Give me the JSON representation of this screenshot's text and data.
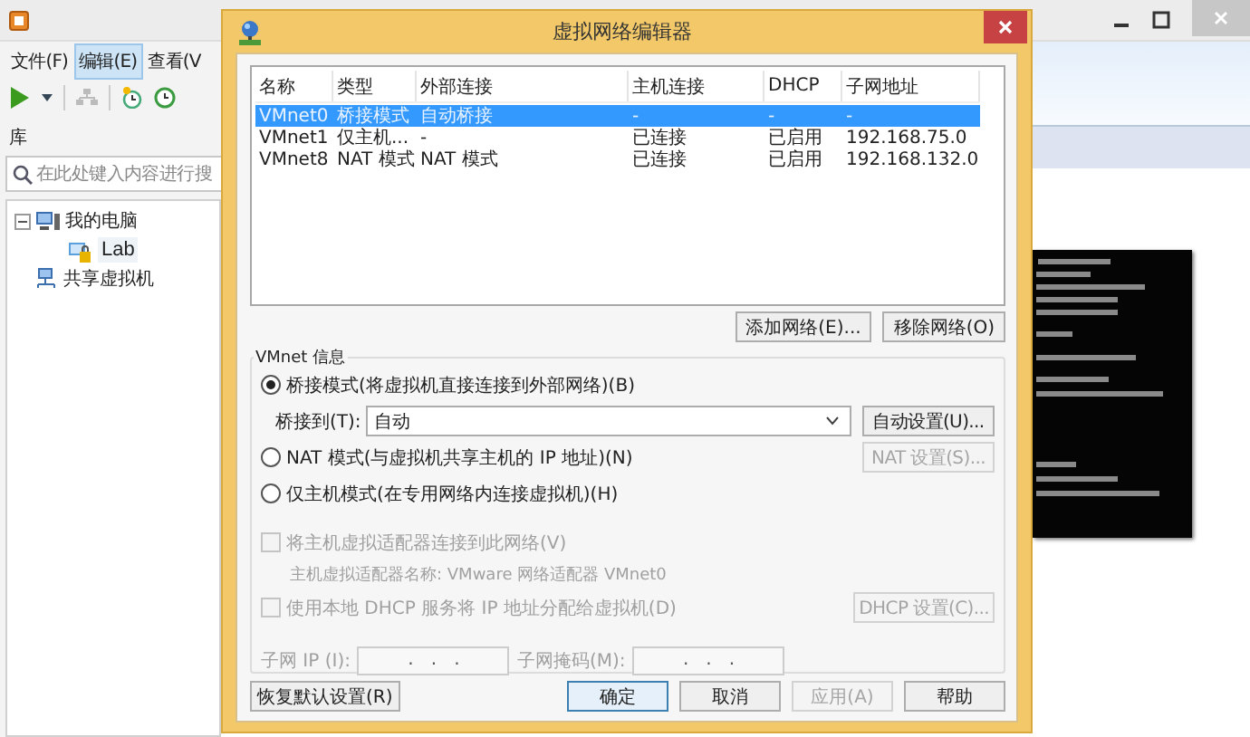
{
  "main_window": {
    "menu": [
      {
        "label": "文件(F)",
        "selected": false
      },
      {
        "label": "编辑(E)",
        "selected": true
      },
      {
        "label": "查看(V",
        "selected": false
      }
    ],
    "library": {
      "title": "库",
      "search": {
        "placeholder": "在此处键入内容进行搜"
      }
    },
    "tree": [
      {
        "label": "我的电脑",
        "kind": "computer",
        "selected": false,
        "expanded": true,
        "children": [
          {
            "label": "Lab",
            "kind": "vm",
            "selected": true
          }
        ]
      },
      {
        "label": "共享虚拟机",
        "kind": "shared",
        "selected": false
      }
    ]
  },
  "dialog": {
    "title": "虚拟网络编辑器",
    "columns": [
      "名称",
      "类型",
      "外部连接",
      "主机连接",
      "DHCP",
      "子网地址"
    ],
    "rows": [
      {
        "cells": [
          "VMnet0",
          "桥接模式",
          "自动桥接",
          "-",
          "-",
          "-"
        ],
        "selected": true
      },
      {
        "cells": [
          "VMnet1",
          "仅主机...",
          "-",
          "已连接",
          "已启用",
          "192.168.75.0"
        ],
        "selected": false
      },
      {
        "cells": [
          "VMnet8",
          "NAT 模式",
          "NAT 模式",
          "已连接",
          "已启用",
          "192.168.132.0"
        ],
        "selected": false
      }
    ],
    "list_buttons": [
      {
        "label": "添加网络(E)...",
        "disabled": false
      },
      {
        "label": "移除网络(O)",
        "disabled": false
      }
    ],
    "group": {
      "title": "VMnet 信息",
      "modes": [
        {
          "label": "桥接模式(将虚拟机直接连接到外部网络)(B)",
          "selected": true
        },
        {
          "label": "NAT 模式(与虚拟机共享主机的 IP 地址)(N)",
          "selected": false,
          "button": {
            "label": "NAT 设置(S)...",
            "disabled": true
          }
        },
        {
          "label": "仅主机模式(在专用网络内连接虚拟机)(H)",
          "selected": false
        }
      ],
      "bridge_to": {
        "label": "桥接到(T):",
        "value": "自动",
        "button": {
          "label": "自动设置(U)...",
          "disabled": false
        }
      },
      "connect_adapter": {
        "label": "将主机虚拟适配器连接到此网络(V)",
        "checked": false,
        "disabled": true
      },
      "adapter_name": {
        "text": "主机虚拟适配器名称: VMware 网络适配器 VMnet0",
        "disabled": true
      },
      "dhcp": {
        "label": "使用本地 DHCP 服务将 IP 地址分配给虚拟机(D)",
        "checked": false,
        "disabled": true,
        "button": {
          "label": "DHCP 设置(C)...",
          "disabled": true
        }
      },
      "subnet_ip": {
        "label": "子网 IP (I):",
        "value": ".   .   .",
        "disabled": true
      },
      "subnet_mask": {
        "label": "子网掩码(M):",
        "value": ".   .   .",
        "disabled": true
      }
    },
    "restore_button": {
      "label": "恢复默认设置(R)",
      "disabled": false
    },
    "buttons": [
      {
        "label": "确定",
        "default": true,
        "disabled": false
      },
      {
        "label": "取消",
        "default": false,
        "disabled": false
      },
      {
        "label": "应用(A)",
        "default": false,
        "disabled": true
      },
      {
        "label": "帮助",
        "default": false,
        "disabled": false
      }
    ]
  }
}
